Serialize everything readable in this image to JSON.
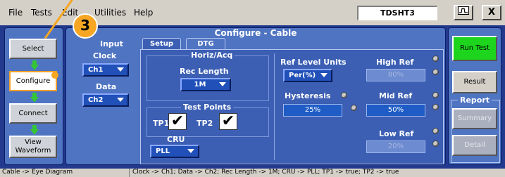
{
  "menu": {
    "items": [
      "File",
      "Tests",
      "Edit",
      "Utilities",
      "Help"
    ]
  },
  "app_title": "TDSHT3",
  "window_buttons": {
    "restore_icon": "scope-icon",
    "close_label": "X"
  },
  "callout": {
    "number": "3"
  },
  "nav": {
    "select": "Select",
    "configure": "Configure",
    "connect": "Connect",
    "view_waveform": "View Waveform"
  },
  "config": {
    "title": "Configure - Cable",
    "input_label": "Input",
    "clock_label": "Clock",
    "clock_value": "Ch1",
    "data_label": "Data",
    "data_value": "Ch2",
    "tabs": [
      {
        "label": "Setup",
        "active": true
      },
      {
        "label": "DTG",
        "active": false
      }
    ],
    "horiz_acq_title": "Horiz/Acq",
    "rec_length_label": "Rec Length",
    "rec_length_value": "1M",
    "test_points_title": "Test Points",
    "tp1_label": "TP1",
    "tp1_checked": true,
    "tp2_label": "TP2",
    "tp2_checked": true,
    "cru_label": "CRU",
    "cru_value": "PLL",
    "ref_level_units_label": "Ref Level Units",
    "ref_level_units_value": "Per(%)",
    "hysteresis_label": "Hysteresis",
    "hysteresis_value": "25%",
    "high_ref_label": "High Ref",
    "high_ref_value": "80%",
    "mid_ref_label": "Mid Ref",
    "mid_ref_value": "50%",
    "low_ref_label": "Low Ref",
    "low_ref_value": "20%"
  },
  "right": {
    "run_test": "Run Test",
    "result": "Result",
    "report_title": "Report",
    "summary": "Summary",
    "detail": "Detail"
  },
  "status": {
    "left": "Cable -> Eye Diagram",
    "right": "Clock -> Ch1; Data -> Ch2; Rec Length -> 1M; CRU -> PLL; TP1 -> true; TP2 -> true"
  },
  "colors": {
    "frame": "#22398d",
    "panel": "#4f74c2",
    "run_button": "#1dd51d",
    "callout": "#f6a623",
    "field": "#1f5cc5"
  }
}
